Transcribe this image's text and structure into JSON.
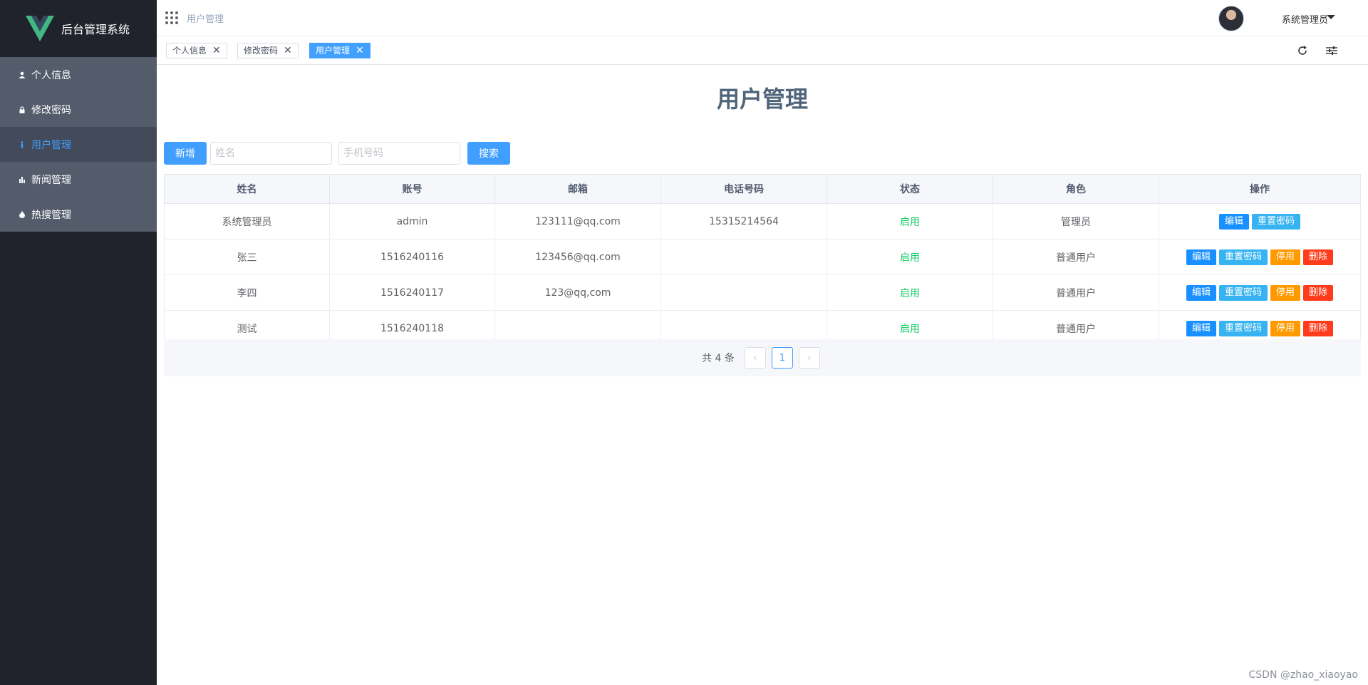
{
  "app": {
    "title": "后台管理系统"
  },
  "sidebar": {
    "items": [
      {
        "label": "个人信息"
      },
      {
        "label": "修改密码"
      },
      {
        "label": "用户管理",
        "active": true
      },
      {
        "label": "新闻管理"
      },
      {
        "label": "热搜管理"
      }
    ]
  },
  "header": {
    "breadcrumb": "用户管理",
    "user_name": "系统管理员"
  },
  "tags": [
    {
      "label": "个人信息"
    },
    {
      "label": "修改密码"
    },
    {
      "label": "用户管理",
      "active": true
    }
  ],
  "page": {
    "title": "用户管理",
    "add_label": "新增",
    "name_placeholder": "姓名",
    "phone_placeholder": "手机号码",
    "search_label": "搜索"
  },
  "table": {
    "headers": [
      "姓名",
      "账号",
      "邮箱",
      "电话号码",
      "状态",
      "角色",
      "操作"
    ],
    "rows": [
      {
        "name": "系统管理员",
        "account": "admin",
        "email": "123111@qq.com",
        "phone": "15315214564",
        "status": "启用",
        "role": "管理员"
      },
      {
        "name": "张三",
        "account": "1516240116",
        "email": "123456@qq.com",
        "phone": "",
        "status": "启用",
        "role": "普通用户"
      },
      {
        "name": "李四",
        "account": "1516240117",
        "email": "123@qq,com",
        "phone": "",
        "status": "启用",
        "role": "普通用户"
      },
      {
        "name": "测试",
        "account": "1516240118",
        "email": "",
        "phone": "",
        "status": "启用",
        "role": "普通用户"
      }
    ],
    "ops": {
      "edit": "编辑",
      "reset": "重置密码",
      "disable": "停用",
      "delete": "删除"
    }
  },
  "pager": {
    "total": "共 4 条",
    "current": "1"
  },
  "watermark": "CSDN @zhao_xiaoyao",
  "colors": {
    "primary": "#409eff",
    "sidebar": "#20232c",
    "menu": "#545c6c",
    "success": "#13ce66"
  }
}
